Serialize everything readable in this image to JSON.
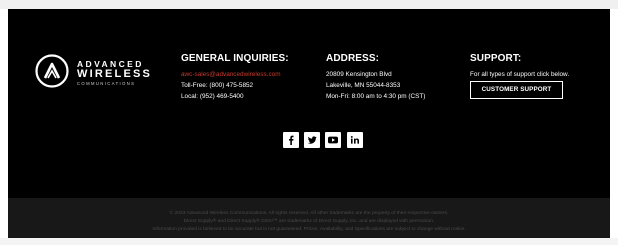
{
  "brand": {
    "line1": "ADVANCED",
    "line2": "WIRELESS",
    "line3": "COMMUNICATIONS"
  },
  "general": {
    "title": "GENERAL INQUIRIES:",
    "email": "awc-sales@advancedwireless.com",
    "tollfree": "Toll-Free: (800) 475-5852",
    "local": "Local: (952) 469-5400"
  },
  "address": {
    "title": "ADDRESS:",
    "street": "20809 Kensington Blvd",
    "city": "Lakeville, MN 55044-8353",
    "hours": "Mon-Fri: 8:00 am to 4:30 pm (CST)"
  },
  "support": {
    "title": "SUPPORT:",
    "text": "For all types of support click below.",
    "button": "CUSTOMER SUPPORT"
  },
  "social": [
    {
      "icon": "facebook-icon",
      "glyph": "f"
    },
    {
      "icon": "twitter-icon",
      "glyph": "twitter"
    },
    {
      "icon": "youtube-icon",
      "glyph": "play"
    },
    {
      "icon": "linkedin-icon",
      "glyph": "in"
    }
  ],
  "legal": {
    "line1": "© 2023 Advanced Wireless Communications. All rights reserved. All other trademarks are the property of their respective owners.",
    "line2": "Direct Supply® and Direct Supply® DSSI™ are trademarks of Direct Supply, Inc. and are displayed with permission.",
    "line3": "Information provided is believed to be accurate but is not guaranteed. Prices, Availability, and Specifications are subject to change without notice."
  },
  "colors": {
    "background": "#000000",
    "bottom_bar": "#181818",
    "accent": "#c43a2e",
    "text": "#ffffff",
    "legal_text": "#4a4a4a"
  }
}
